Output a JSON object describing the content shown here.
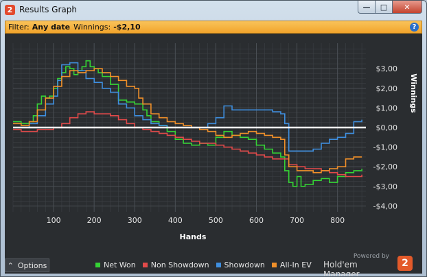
{
  "window": {
    "title": "Results Graph",
    "controls": {
      "minimize": "—",
      "maximize": "□",
      "close": "✕"
    },
    "app_icon_glyph": "2"
  },
  "filter": {
    "prefix": "Filter:",
    "date_value": "Any date",
    "winnings_label": "Winnings:",
    "winnings_value": "-$2,10",
    "help_glyph": "?"
  },
  "footer": {
    "options_label": "Options",
    "powered_by": "Powered by",
    "brand": "Hold'em Manager",
    "brand_logo_glyph": "2"
  },
  "colors": {
    "net_won": "#35d335",
    "non_showdown": "#e24a4a",
    "showdown": "#3f8fdf",
    "allin_ev": "#f0902a",
    "zero_line": "#ffffff",
    "grid": "#3c4044",
    "plot_bg": "#2a2d30"
  },
  "chart_data": {
    "type": "line",
    "xlabel": "Hands",
    "ylabel": "Winnings",
    "xlim": [
      0,
      870
    ],
    "ylim": [
      -4.3,
      4.3
    ],
    "x_ticks": [
      100,
      200,
      300,
      400,
      500,
      600,
      700,
      800
    ],
    "x_tick_labels": [
      "100",
      "200",
      "300",
      "400",
      "500",
      "600",
      "700",
      "800"
    ],
    "y_ticks": [
      3,
      2,
      1,
      0,
      -1,
      -2,
      -3,
      -4
    ],
    "y_tick_labels": [
      "$3,00",
      "$2,00",
      "$1,00",
      "$0,00",
      "-$1,00",
      "-$2,00",
      "-$3,00",
      "-$4,00"
    ],
    "grid": true,
    "legend_position": "bottom",
    "series": [
      {
        "name": "Net Won",
        "key": "net_won",
        "x": [
          0,
          20,
          40,
          50,
          60,
          70,
          80,
          90,
          100,
          110,
          120,
          130,
          140,
          150,
          160,
          170,
          180,
          190,
          200,
          210,
          220,
          230,
          240,
          260,
          280,
          300,
          320,
          330,
          340,
          360,
          380,
          400,
          420,
          440,
          460,
          480,
          500,
          520,
          540,
          560,
          580,
          600,
          620,
          640,
          660,
          670,
          680,
          690,
          700,
          710,
          720,
          740,
          760,
          780,
          800,
          820,
          840,
          860
        ],
        "y": [
          0.3,
          0.2,
          0.3,
          0.6,
          1.2,
          1.6,
          1.5,
          1.6,
          2.0,
          2.5,
          2.8,
          3.1,
          3.0,
          2.7,
          2.9,
          3.1,
          3.4,
          3.1,
          3.0,
          2.8,
          2.6,
          2.6,
          2.2,
          1.4,
          1.3,
          1.2,
          0.9,
          0.6,
          0.3,
          0.1,
          -0.2,
          -0.6,
          -0.8,
          -0.9,
          -0.8,
          -0.9,
          -0.5,
          -0.2,
          -0.4,
          -0.5,
          -0.6,
          -0.9,
          -1.1,
          -1.3,
          -1.5,
          -2.2,
          -2.8,
          -3.0,
          -2.5,
          -3.0,
          -2.9,
          -2.7,
          -2.6,
          -2.8,
          -2.5,
          -2.3,
          -2.2,
          -2.1
        ]
      },
      {
        "name": "Non Showdown",
        "key": "non_showdown",
        "x": [
          0,
          20,
          40,
          60,
          80,
          100,
          120,
          140,
          160,
          180,
          200,
          220,
          240,
          260,
          280,
          300,
          320,
          340,
          360,
          380,
          400,
          420,
          440,
          460,
          480,
          500,
          520,
          540,
          560,
          580,
          600,
          620,
          640,
          660,
          680,
          700,
          720,
          740,
          760,
          780,
          800,
          820,
          840,
          860
        ],
        "y": [
          -0.1,
          -0.2,
          -0.2,
          -0.1,
          -0.1,
          0.0,
          0.2,
          0.5,
          0.7,
          0.8,
          0.7,
          0.7,
          0.6,
          0.4,
          0.2,
          0.0,
          -0.1,
          -0.2,
          -0.3,
          -0.4,
          -0.5,
          -0.6,
          -0.7,
          -0.8,
          -0.8,
          -0.9,
          -1.0,
          -1.1,
          -1.2,
          -1.3,
          -1.4,
          -1.5,
          -1.6,
          -1.6,
          -1.9,
          -2.0,
          -2.1,
          -2.1,
          -2.2,
          -2.3,
          -2.4,
          -2.5,
          -2.5,
          -2.4
        ]
      },
      {
        "name": "Showdown",
        "key": "showdown",
        "x": [
          0,
          20,
          40,
          60,
          80,
          100,
          110,
          120,
          140,
          160,
          180,
          200,
          220,
          240,
          260,
          280,
          300,
          320,
          340,
          360,
          380,
          400,
          420,
          440,
          460,
          480,
          500,
          520,
          540,
          560,
          580,
          600,
          620,
          640,
          660,
          670,
          680,
          700,
          720,
          740,
          760,
          780,
          800,
          820,
          840,
          860
        ],
        "y": [
          0.0,
          0.0,
          0.2,
          0.6,
          1.2,
          1.6,
          2.4,
          3.2,
          3.3,
          2.9,
          2.5,
          2.3,
          2.0,
          1.8,
          1.2,
          1.0,
          0.6,
          0.4,
          0.2,
          0.1,
          0.0,
          0.0,
          0.0,
          0.0,
          0.0,
          0.2,
          0.5,
          1.1,
          0.9,
          0.9,
          0.9,
          0.9,
          0.9,
          0.8,
          0.7,
          0.2,
          -1.2,
          -1.2,
          -1.2,
          -1.1,
          -0.8,
          -0.6,
          -0.5,
          -0.3,
          0.3,
          0.4
        ]
      },
      {
        "name": "All-In EV",
        "key": "allin_ev",
        "x": [
          0,
          20,
          40,
          60,
          80,
          100,
          120,
          140,
          160,
          180,
          200,
          220,
          240,
          260,
          280,
          300,
          310,
          320,
          340,
          360,
          380,
          400,
          420,
          440,
          460,
          480,
          500,
          520,
          540,
          560,
          580,
          600,
          620,
          640,
          660,
          670,
          680,
          700,
          720,
          740,
          760,
          780,
          800,
          820,
          840,
          860
        ],
        "y": [
          0.2,
          0.1,
          0.3,
          0.9,
          1.5,
          2.1,
          2.6,
          2.9,
          2.8,
          2.9,
          3.0,
          2.8,
          2.6,
          2.4,
          2.1,
          2.0,
          1.5,
          1.2,
          0.7,
          0.5,
          0.3,
          0.2,
          0.1,
          0.0,
          -0.1,
          -0.2,
          -0.4,
          -0.5,
          -0.4,
          -0.3,
          -0.2,
          -0.3,
          -0.4,
          -0.5,
          -0.6,
          -1.4,
          -2.0,
          -2.2,
          -2.2,
          -2.3,
          -2.2,
          -2.1,
          -2.0,
          -1.6,
          -1.5,
          -1.5
        ]
      }
    ]
  }
}
